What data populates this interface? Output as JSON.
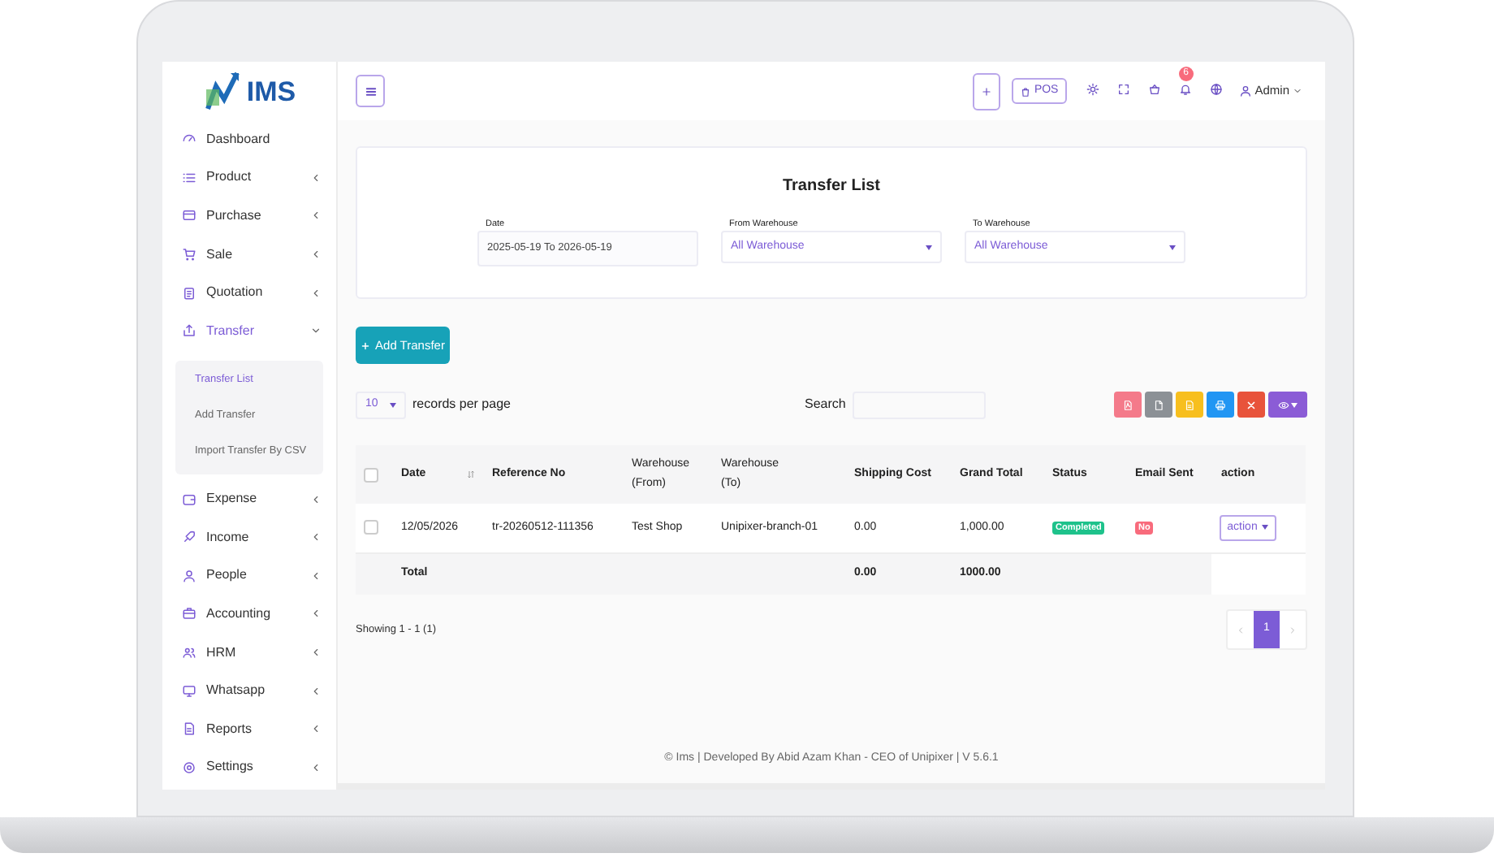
{
  "sidebar": {
    "logo": "IMS",
    "items": [
      {
        "label": "Dashboard",
        "kind": "link",
        "selected": false
      },
      {
        "label": "Product",
        "kind": "group",
        "selected": false,
        "expanded": false
      },
      {
        "label": "Purchase",
        "kind": "group",
        "selected": false,
        "expanded": false
      },
      {
        "label": "Sale",
        "kind": "group",
        "selected": false,
        "expanded": false
      },
      {
        "label": "Quotation",
        "kind": "group",
        "selected": false,
        "expanded": false
      },
      {
        "label": "Transfer",
        "kind": "group",
        "selected": true,
        "expanded": true,
        "children": [
          {
            "label": "Transfer List",
            "selected": true
          },
          {
            "label": "Add Transfer",
            "selected": false
          },
          {
            "label": "Import Transfer By CSV",
            "selected": false
          }
        ]
      },
      {
        "label": "Expense",
        "kind": "group",
        "selected": false,
        "expanded": false
      },
      {
        "label": "Income",
        "kind": "group",
        "selected": false,
        "expanded": false
      },
      {
        "label": "People",
        "kind": "group",
        "selected": false,
        "expanded": false
      },
      {
        "label": "Accounting",
        "kind": "group",
        "selected": false,
        "expanded": false
      },
      {
        "label": "HRM",
        "kind": "group",
        "selected": false,
        "expanded": false
      },
      {
        "label": "Whatsapp",
        "kind": "group",
        "selected": false,
        "expanded": false
      },
      {
        "label": "Reports",
        "kind": "group",
        "selected": false,
        "expanded": false
      },
      {
        "label": "Settings",
        "kind": "group",
        "selected": false,
        "expanded": false
      }
    ]
  },
  "header": {
    "pos_label": "POS",
    "notification_count": "6",
    "user": "Admin"
  },
  "filter_card": {
    "title": "Transfer List",
    "filters": [
      {
        "label": "Date",
        "value": "2025-05-19 To 2026-05-19",
        "kind": "input"
      },
      {
        "label": "From Warehouse",
        "value": "All Warehouse",
        "kind": "select"
      },
      {
        "label": "To Warehouse",
        "value": "All Warehouse",
        "kind": "select"
      }
    ]
  },
  "add_button": "Add Transfer",
  "toolbar": {
    "page_size": "10",
    "page_size_label": "records per page",
    "search_label": "Search",
    "export_buttons": [
      {
        "kind": "pdf",
        "color": "#f47a8a"
      },
      {
        "kind": "csv",
        "color": "#8c9196"
      },
      {
        "kind": "excel",
        "color": "#f7bf1e"
      },
      {
        "kind": "print",
        "color": "#2196f3"
      },
      {
        "kind": "reset",
        "color": "#e8533b"
      },
      {
        "kind": "columns",
        "color": "#8b5cd6"
      }
    ]
  },
  "table": {
    "select_all_checked": false,
    "columns": [
      "Date",
      "Reference No",
      "Warehouse (From)",
      "Warehouse (To)",
      "Shipping Cost",
      "Grand Total",
      "Status",
      "Email Sent",
      "action"
    ],
    "rows": [
      {
        "checked": false,
        "cells": [
          "12/05/2026",
          "tr-20260512-111356",
          "Test Shop",
          "Unipixer-branch-01",
          "0.00",
          "1,000.00"
        ],
        "status": {
          "text": "Completed",
          "color": "#1ec28b"
        },
        "email": {
          "text": "No",
          "color": "#f86b7c"
        },
        "action": "action"
      }
    ],
    "total": {
      "label": "Total",
      "shipping": "0.00",
      "grand": "1000.00"
    }
  },
  "showing": "Showing 1 - 1 (1)",
  "pagination": [
    {
      "label": "1",
      "selected": true
    }
  ],
  "footer": "© Ims | Developed By Abid Azam Khan - CEO of Unipixer | V 5.6.1"
}
